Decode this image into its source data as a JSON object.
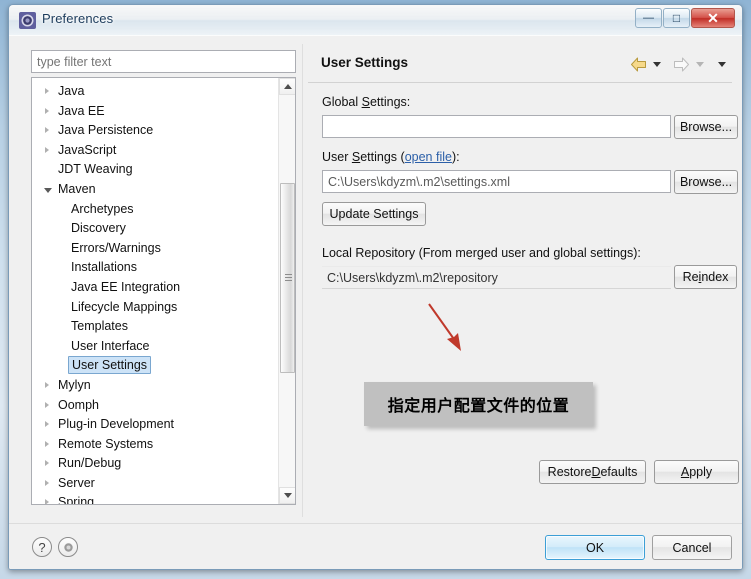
{
  "window": {
    "title": "Preferences",
    "icon": "preferences-gear-icon",
    "minimize_label": "—",
    "maximize_label": "□",
    "close_label": "✕"
  },
  "sidebar": {
    "filter": {
      "placeholder": "type filter text",
      "value": ""
    },
    "items": [
      {
        "label": "Java",
        "depth": 1,
        "state": "collapsed"
      },
      {
        "label": "Java EE",
        "depth": 1,
        "state": "collapsed"
      },
      {
        "label": "Java Persistence",
        "depth": 1,
        "state": "collapsed"
      },
      {
        "label": "JavaScript",
        "depth": 1,
        "state": "collapsed"
      },
      {
        "label": "JDT Weaving",
        "depth": 1,
        "state": "leaf"
      },
      {
        "label": "Maven",
        "depth": 1,
        "state": "expanded"
      },
      {
        "label": "Archetypes",
        "depth": 2,
        "state": "leaf"
      },
      {
        "label": "Discovery",
        "depth": 2,
        "state": "leaf"
      },
      {
        "label": "Errors/Warnings",
        "depth": 2,
        "state": "leaf"
      },
      {
        "label": "Installations",
        "depth": 2,
        "state": "leaf"
      },
      {
        "label": "Java EE Integration",
        "depth": 2,
        "state": "leaf"
      },
      {
        "label": "Lifecycle Mappings",
        "depth": 2,
        "state": "leaf"
      },
      {
        "label": "Templates",
        "depth": 2,
        "state": "leaf"
      },
      {
        "label": "User Interface",
        "depth": 2,
        "state": "leaf"
      },
      {
        "label": "User Settings",
        "depth": 2,
        "state": "leaf",
        "selected": true
      },
      {
        "label": "Mylyn",
        "depth": 1,
        "state": "collapsed"
      },
      {
        "label": "Oomph",
        "depth": 1,
        "state": "collapsed"
      },
      {
        "label": "Plug-in Development",
        "depth": 1,
        "state": "collapsed"
      },
      {
        "label": "Remote Systems",
        "depth": 1,
        "state": "collapsed"
      },
      {
        "label": "Run/Debug",
        "depth": 1,
        "state": "collapsed"
      },
      {
        "label": "Server",
        "depth": 1,
        "state": "collapsed"
      },
      {
        "label": "Spring",
        "depth": 1,
        "state": "collapsed"
      }
    ],
    "selected_item": "User Settings",
    "scrollbar": {
      "up_icon": "scroll-up-icon",
      "down_icon": "scroll-down-icon"
    }
  },
  "page": {
    "title": "User Settings",
    "nav": {
      "back_icon": "back-arrow-icon",
      "back_menu_icon": "chevron-down-icon",
      "forward_icon": "forward-arrow-icon",
      "forward_menu_icon": "chevron-down-icon",
      "overflow_icon": "chevron-down-icon"
    },
    "global_settings": {
      "label_prefix": "Global ",
      "label_mnemonic": "S",
      "label_suffix": "ettings:",
      "value": "",
      "browse_label": "Browse..."
    },
    "user_settings": {
      "label_prefix": "User ",
      "label_mnemonic": "S",
      "label_mid": "ettings (",
      "link_label": "open file",
      "label_suffix": "):",
      "value": "C:\\Users\\kdyzm\\.m2\\settings.xml",
      "browse_label": "Browse...",
      "update_label": "Update Settings"
    },
    "local_repository": {
      "label": "Local Repository (From merged user and global settings):",
      "value": "C:\\Users\\kdyzm\\.m2\\repository",
      "reindex_prefix": "Re",
      "reindex_mnemonic": "i",
      "reindex_suffix": "ndex"
    },
    "restore_defaults": {
      "prefix": "Restore ",
      "mnemonic": "D",
      "suffix": "efaults"
    },
    "apply": {
      "prefix": "",
      "mnemonic": "A",
      "suffix": "pply"
    }
  },
  "annotation": {
    "text": "指定用户配置文件的位置",
    "arrow_color": "#c0392b",
    "box_color": "#c0c0c0"
  },
  "footer": {
    "help_icon": "question-mark-icon",
    "info_icon": "info-circle-icon",
    "ok_label": "OK",
    "cancel_label": "Cancel"
  },
  "colors": {
    "selection_bg": "#cde3f7",
    "selection_border": "#7aa7d0",
    "link": "#2b5fa8",
    "ok_accent": "#3c9fd6",
    "annotation_red": "#c0392b"
  }
}
